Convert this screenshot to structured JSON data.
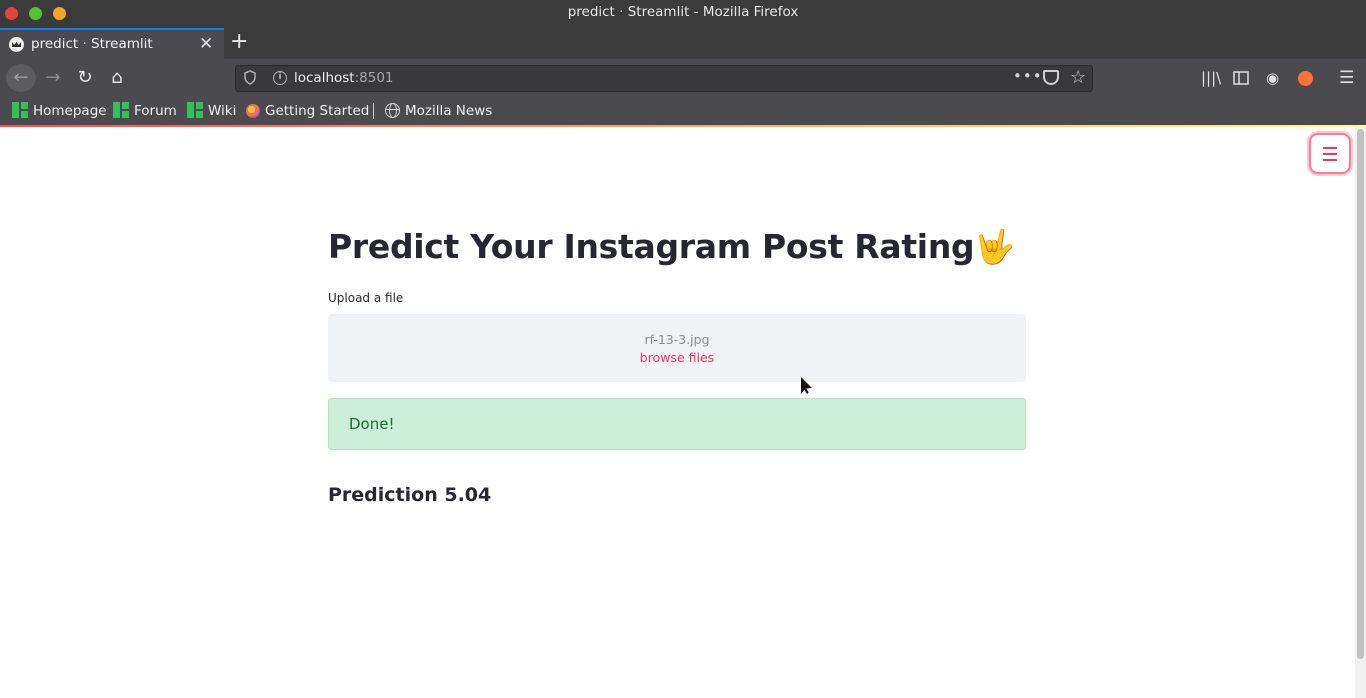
{
  "window": {
    "title": "predict · Streamlit - Mozilla Firefox"
  },
  "tabs": [
    {
      "title": "predict · Streamlit",
      "active": true
    }
  ],
  "toolbar": {
    "url_host": "localhost",
    "url_port": ":8501"
  },
  "bookmarks": [
    {
      "label": "Homepage",
      "icon": "manjaro-icon"
    },
    {
      "label": "Forum",
      "icon": "manjaro-icon"
    },
    {
      "label": "Wiki",
      "icon": "manjaro-icon"
    },
    {
      "label": "Getting Started",
      "icon": "firefox-icon"
    },
    {
      "label": "Mozilla News",
      "icon": "globe-icon"
    }
  ],
  "app": {
    "title": "Predict Your Instagram Post Rating",
    "title_emoji": "🤟",
    "uploader_label": "Upload a file",
    "uploaded_file": "rf-13-3.jpg",
    "browse_label": "browse files",
    "status_message": "Done!",
    "prediction_text": "Prediction 5.04"
  },
  "colors": {
    "accent": "#f63366",
    "success_bg": "#cdefd7",
    "success_text": "#1e6b32",
    "text": "#262730"
  }
}
